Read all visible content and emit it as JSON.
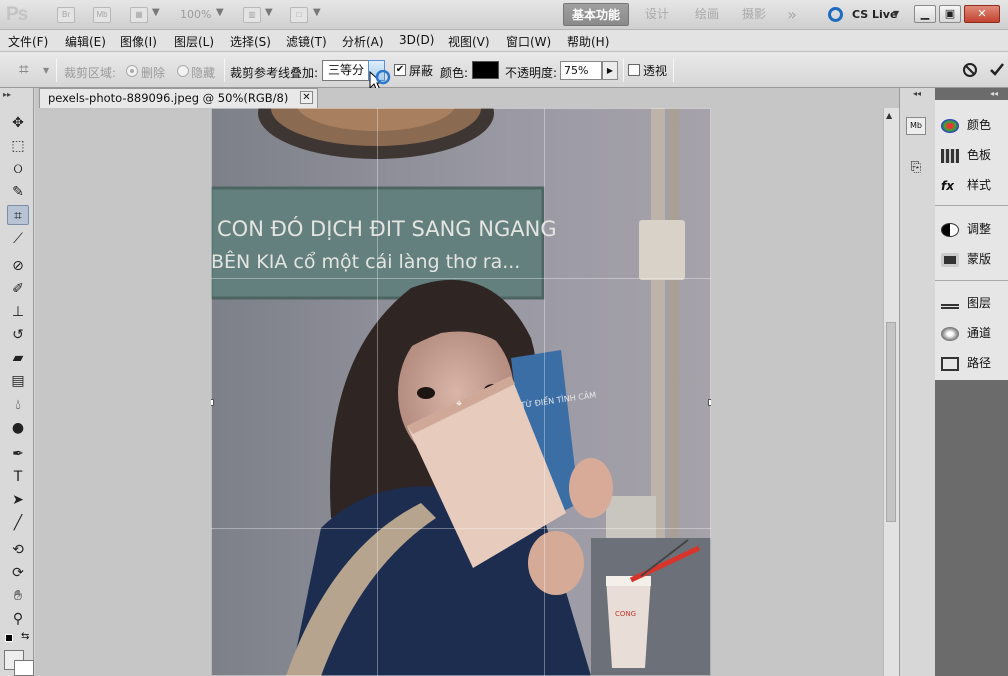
{
  "titlebar": {
    "logo": "Ps",
    "bridge": "Br",
    "minibridge": "Mb",
    "zoom": "100%",
    "workspaces": [
      "基本功能",
      "设计",
      "绘画",
      "摄影"
    ],
    "more": "»",
    "cs_live": "CS Live"
  },
  "menu": [
    "文件(F)",
    "编辑(E)",
    "图像(I)",
    "图层(L)",
    "选择(S)",
    "滤镜(T)",
    "分析(A)",
    "3D(D)",
    "视图(V)",
    "窗口(W)",
    "帮助(H)"
  ],
  "options": {
    "crop_area_label": "裁剪区域:",
    "delete_label": "删除",
    "hide_label": "隐藏",
    "overlay_label": "裁剪参考线叠加:",
    "overlay_value": "三等分",
    "shield_label": "屏蔽",
    "color_label": "颜色:",
    "opacity_label": "不透明度:",
    "opacity_value": "75%",
    "perspective_label": "透视"
  },
  "document": {
    "tab_title": "pexels-photo-889096.jpeg @ 50%(RGB/8)",
    "sign_line1": "CON ĐÓ DỊCH ĐIT SANG NGANG",
    "sign_line2": "BÊN KIA cổ một cái làng thơ ra...",
    "book_text": "TỪ ĐIỂN TÌNH CẢM",
    "cup_text": "CONG"
  },
  "panels": {
    "group1": [
      "颜色",
      "色板",
      "样式"
    ],
    "group2": [
      "调整",
      "蒙版"
    ],
    "group3": [
      "图层",
      "通道",
      "路径"
    ]
  },
  "colors": {
    "mask_color": "#000000",
    "accent": "#5a8fcf"
  }
}
